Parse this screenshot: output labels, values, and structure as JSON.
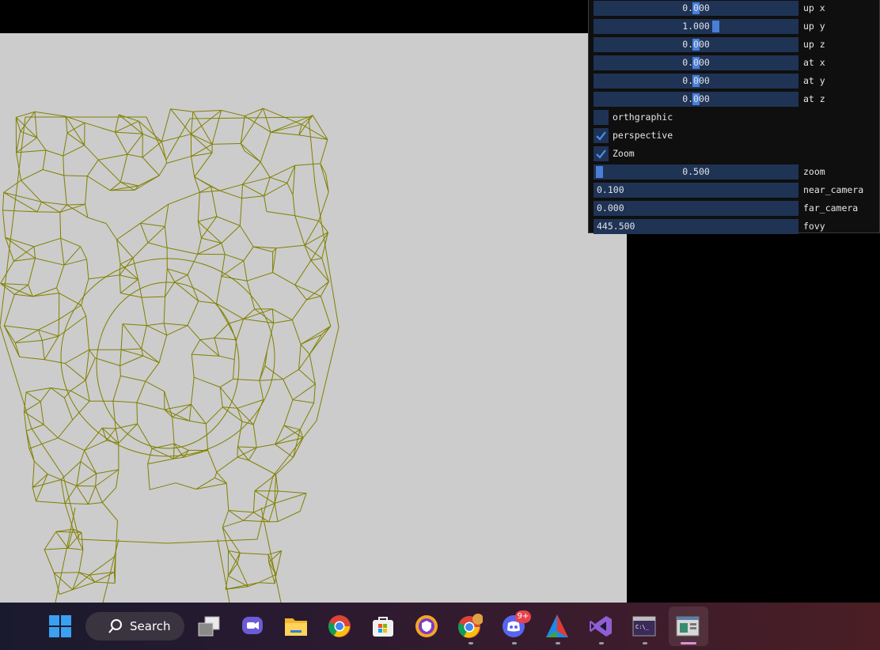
{
  "controls": {
    "sliders": [
      {
        "value": "0.000",
        "label": "up x",
        "grab_fraction": 0.5
      },
      {
        "value": "1.000",
        "label": "up y",
        "grab_fraction": 0.6
      },
      {
        "value": "0.000",
        "label": "up z",
        "grab_fraction": 0.5
      },
      {
        "value": "0.000",
        "label": "at x",
        "grab_fraction": 0.5
      },
      {
        "value": "0.000",
        "label": "at y",
        "grab_fraction": 0.5
      },
      {
        "value": "0.000",
        "label": "at z",
        "grab_fraction": 0.5
      }
    ],
    "checkboxes": [
      {
        "label": "orthgraphic",
        "checked": false
      },
      {
        "label": "perspective",
        "checked": true
      },
      {
        "label": "Zoom",
        "checked": true
      }
    ],
    "zoom": {
      "value": "0.500",
      "label": "zoom",
      "grab_fraction": 0.0
    },
    "inputs": [
      {
        "value": "0.100",
        "label": "near_camera"
      },
      {
        "value": "0.000",
        "label": "far_camera"
      },
      {
        "value": "445.500",
        "label": "fovy"
      }
    ]
  },
  "colors": {
    "viewport_bg": "#cccccc",
    "wireframe": "#808000",
    "panel_bg": "#0f0f0f",
    "frame_bg": "#1f3354",
    "accent": "#4a7fd6"
  },
  "taskbar": {
    "search_label": "Search",
    "discord_badge": "9+",
    "icons": [
      "windows-start-icon",
      "task-view-icon",
      "chat-icon",
      "file-explorer-icon",
      "chrome-icon",
      "store-icon",
      "vpn-shield-icon",
      "chrome-profile-icon",
      "discord-icon",
      "cmake-icon",
      "visual-studio-icon",
      "terminal-icon",
      "app-window-icon"
    ]
  }
}
